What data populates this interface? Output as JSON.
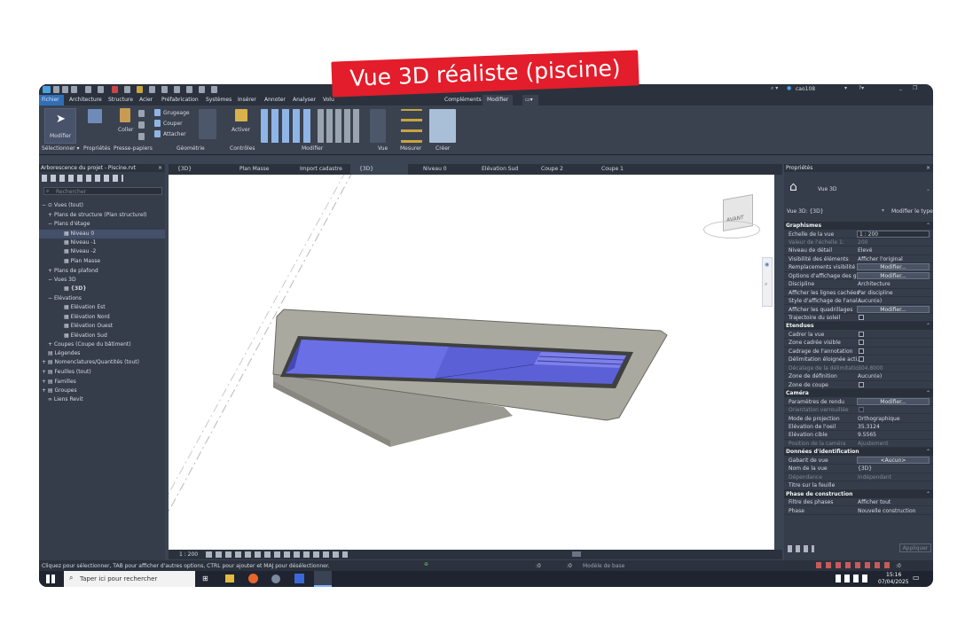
{
  "badge": {
    "text": "Vue 3D réaliste (piscine)"
  },
  "titlebar": {
    "user": "cao108",
    "complements": "Compléments",
    "modifier_tab": "Modifier"
  },
  "menu": {
    "items": [
      "Fichier",
      "Architecture",
      "Structure",
      "Acier",
      "Préfabrication",
      "Systèmes",
      "Insérer",
      "Annoter",
      "Analyser",
      "Volu"
    ]
  },
  "ribbon": {
    "modifier": "Modifier",
    "coller": "Coller",
    "grugeage": "Grugeage",
    "couper": "Couper",
    "attacher": "Attacher",
    "activer": "Activer",
    "panels": [
      "Sélectionner ▾",
      "Propriétés",
      "Presse-papiers",
      "Géométrie",
      "Contrôles",
      "Modifier",
      "Vue",
      "Mesurer",
      "Créer"
    ]
  },
  "project_browser": {
    "title": "Arborescence du projet - Piscine.rvt",
    "search_placeholder": "Rechercher",
    "tree": [
      "Vues (tout)",
      "Plans de structure (Plan structurel)",
      "Plans d'étage",
      "Niveau 0",
      "Niveau -1",
      "Niveau -2",
      "Plan Masse",
      "Plans de plafond",
      "Vues 3D",
      "{3D}",
      "Elévations",
      "Elévation Est",
      "Elévation Nord",
      "Elévation Ouest",
      "Elévation Sud",
      "Coupes (Coupe du bâtiment)",
      "Légendes",
      "Nomenclatures/Quantités (tout)",
      "Feuilles (tout)",
      "Familles",
      "Groupes",
      "Liens Revit"
    ]
  },
  "view_tabs": [
    "{3D}",
    "Plan Masse",
    "Import cadastre",
    "{3D}",
    "Niveau 0",
    "Elévation Sud",
    "Coupe 2",
    "Coupe 1"
  ],
  "viewcube": {
    "label": "AVANT"
  },
  "view_bar": {
    "scale": "1 : 200"
  },
  "properties": {
    "title": "Propriétés",
    "type_name": "Vue 3D",
    "selector": "Vue 3D: {3D}",
    "edit_type": "Modifier le type",
    "sections": [
      {
        "name": "Graphismes",
        "rows": [
          {
            "k": "Echelle de la vue",
            "v": "1 : 200",
            "kind": "input"
          },
          {
            "k": "Valeur de l'échelle    1:",
            "v": "200",
            "kind": "dim"
          },
          {
            "k": "Niveau de détail",
            "v": "Elevé",
            "kind": "text"
          },
          {
            "k": "Visibilité des éléments",
            "v": "Afficher l'original",
            "kind": "text"
          },
          {
            "k": "Remplacements visibilité ...",
            "v": "Modifier...",
            "kind": "button"
          },
          {
            "k": "Options d'affichage des g...",
            "v": "Modifier...",
            "kind": "button"
          },
          {
            "k": "Discipline",
            "v": "Architecture",
            "kind": "text"
          },
          {
            "k": "Afficher les lignes cachées",
            "v": "Par discipline",
            "kind": "text"
          },
          {
            "k": "Style d'affichage de l'anal...",
            "v": "Aucun(e)",
            "kind": "text"
          },
          {
            "k": "Afficher les quadrillages",
            "v": "Modifier...",
            "kind": "button"
          },
          {
            "k": "Trajectoire du soleil",
            "v": "",
            "kind": "check"
          }
        ]
      },
      {
        "name": "Etendues",
        "rows": [
          {
            "k": "Cadrer la vue",
            "v": "",
            "kind": "check"
          },
          {
            "k": "Zone cadrée visible",
            "v": "",
            "kind": "check"
          },
          {
            "k": "Cadrage de l'annotation",
            "v": "",
            "kind": "check"
          },
          {
            "k": "Délimitation éloignée acti...",
            "v": "",
            "kind": "check"
          },
          {
            "k": "Décalage de la délimitatio...",
            "v": "304.8000",
            "kind": "dim"
          },
          {
            "k": "Zone de définition",
            "v": "Aucun(e)",
            "kind": "text"
          },
          {
            "k": "Zone de coupe",
            "v": "",
            "kind": "check"
          }
        ]
      },
      {
        "name": "Caméra",
        "rows": [
          {
            "k": "Paramètres de rendu",
            "v": "Modifier...",
            "kind": "button"
          },
          {
            "k": "Orientation verrouillée",
            "v": "",
            "kind": "dimcheck"
          },
          {
            "k": "Mode de projection",
            "v": "Orthographique",
            "kind": "text"
          },
          {
            "k": "Elévation de l'oeil",
            "v": "35.3124",
            "kind": "text"
          },
          {
            "k": "Elévation cible",
            "v": "9.5565",
            "kind": "text"
          },
          {
            "k": "Position de la caméra",
            "v": "Ajustement",
            "kind": "dim"
          }
        ]
      },
      {
        "name": "Données d'identification",
        "rows": [
          {
            "k": "Gabarit de vue",
            "v": "<Aucun>",
            "kind": "button"
          },
          {
            "k": "Nom de la vue",
            "v": "{3D}",
            "kind": "text"
          },
          {
            "k": "Dépendance",
            "v": "Indépendant",
            "kind": "dim"
          },
          {
            "k": "Titre sur la feuille",
            "v": "",
            "kind": "text"
          }
        ]
      },
      {
        "name": "Phase de construction",
        "rows": [
          {
            "k": "Filtre des phases",
            "v": "Afficher tout",
            "kind": "text"
          },
          {
            "k": "Phase",
            "v": "Nouvelle construction",
            "kind": "text"
          }
        ]
      }
    ],
    "apply": "Appliquer"
  },
  "status_bar": {
    "message": "Cliquez pour sélectionner, TAB pour afficher d'autres options, CTRL pour ajouter et MAJ pour désélectionner.",
    "model": "Modèle de base",
    "zero1": ":0",
    "zero2": ":0",
    "zero3": ":0"
  },
  "taskbar": {
    "search": "Taper ici pour rechercher",
    "time": "15:16",
    "date": "07/04/2025"
  },
  "colors": {
    "accent": "#e31d2b",
    "water": "#5b5fd8",
    "concrete": "#a4a49c"
  }
}
